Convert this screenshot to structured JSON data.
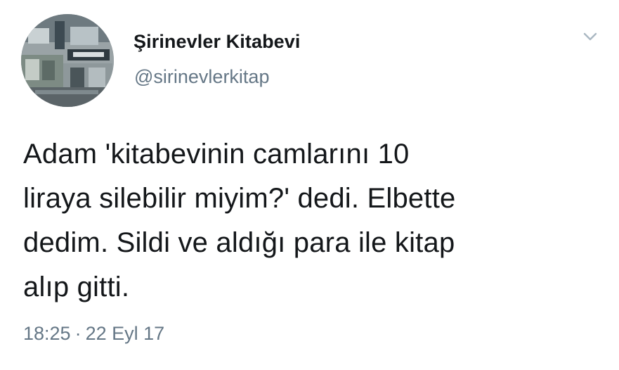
{
  "tweet": {
    "author": {
      "name": "Şirinevler Kitabevi",
      "handle": "@sirinevlerkitap"
    },
    "text_lines": [
      "Adam 'kitabevinin camlarını 10",
      "liraya silebilir miyim?' dedi. Elbette",
      "dedim. Sildi ve aldığı para ile kitap",
      "alıp gitti."
    ],
    "time": "18:25",
    "separator": "·",
    "date": "22 Eyl 17"
  },
  "colors": {
    "text": "#14171a",
    "secondary": "#657786",
    "caret": "#aab8c2",
    "background": "#ffffff"
  },
  "icons": {
    "menu": "chevron-down-icon",
    "avatar": "bookstore-storefront-photo"
  }
}
